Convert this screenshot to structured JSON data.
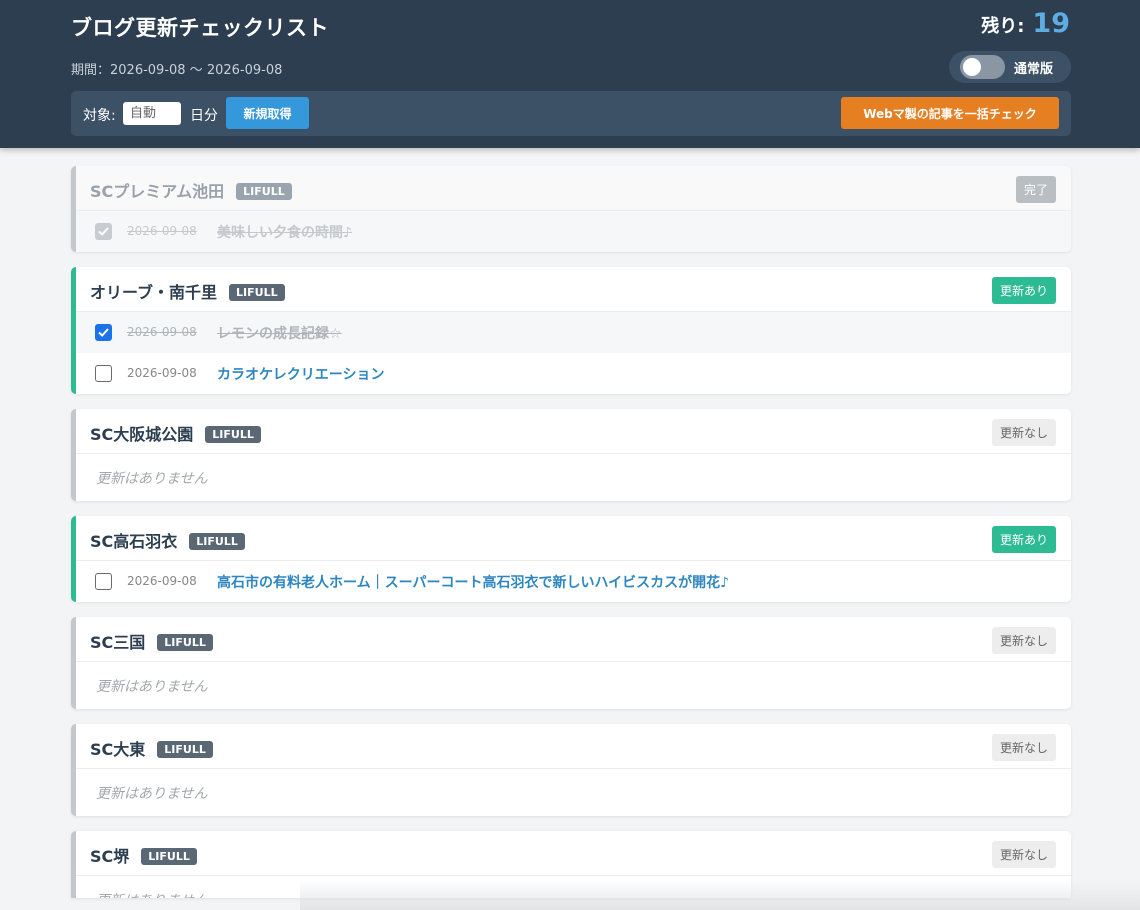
{
  "header": {
    "title": "ブログ更新チェックリスト",
    "period": "期間：2026-09-08 〜 2026-09-08",
    "remaining_label": "残り:",
    "remaining_count": "19",
    "mode_label": "通常版"
  },
  "toolbar": {
    "target_label": "対象:",
    "days_placeholder": "自動",
    "days_unit": "日分",
    "fetch_label": "新規取得",
    "bulk_check_label": "Webマ製の記事を一括チェック"
  },
  "colors": {
    "header_bg": "#2c3e50",
    "accent_blue": "#3498db",
    "accent_orange": "#e67e22",
    "updated_green": "#2dbb93",
    "count_blue": "#5dade2"
  },
  "cards": [
    {
      "name": "SCプレミアム池田",
      "source": "LIFULL",
      "status": "完了",
      "posts": [
        {
          "date": "2026-09-08",
          "title": "美味しい夕食の時間♪",
          "checked": true
        }
      ]
    },
    {
      "name": "オリーブ・南千里",
      "source": "LIFULL",
      "status": "更新あり",
      "posts": [
        {
          "date": "2026-09-08",
          "title": "レモンの成長記録☆",
          "checked": true
        },
        {
          "date": "2026-09-08",
          "title": "カラオケレクリエーション",
          "checked": false
        }
      ]
    },
    {
      "name": "SC大阪城公園",
      "source": "LIFULL",
      "status": "更新なし",
      "empty": "更新はありません"
    },
    {
      "name": "SC高石羽衣",
      "source": "LIFULL",
      "status": "更新あり",
      "posts": [
        {
          "date": "2026-09-08",
          "title": "高石市の有料老人ホーム｜スーパーコート高石羽衣で新しいハイビスカスが開花♪",
          "checked": false
        }
      ]
    },
    {
      "name": "SC三国",
      "source": "LIFULL",
      "status": "更新なし",
      "empty": "更新はありません"
    },
    {
      "name": "SC大東",
      "source": "LIFULL",
      "status": "更新なし",
      "empty": "更新はありません"
    },
    {
      "name": "SC堺",
      "source": "LIFULL",
      "status": "更新なし",
      "empty": "更新はありません"
    }
  ]
}
